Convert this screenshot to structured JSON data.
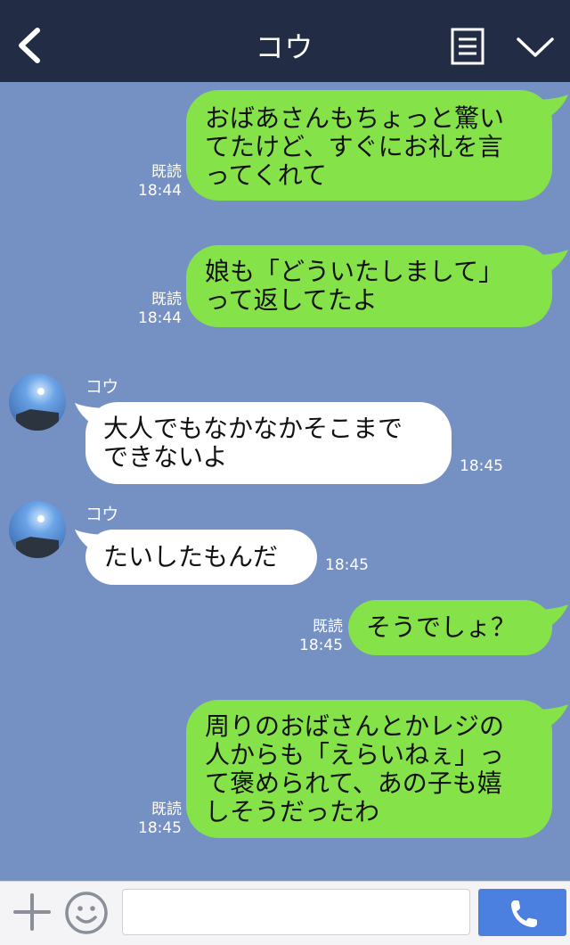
{
  "header": {
    "title": "コウ",
    "back_icon": "chevron-left-icon",
    "menu_icon": "note-list-icon",
    "collapse_icon": "chevron-down-icon"
  },
  "messages": [
    {
      "from": "me",
      "lines": [
        "おばあさんもちょっと驚い",
        "てたけど、すぐにお礼を言",
        "ってくれて"
      ],
      "read": "既読",
      "time": "18:44"
    },
    {
      "from": "me",
      "lines": [
        "娘も「どういたしまして」",
        "って返してたよ"
      ],
      "read": "既読",
      "time": "18:44"
    },
    {
      "from": "them",
      "sender": "コウ",
      "lines": [
        "大人でもなかなかそこまで",
        "できないよ"
      ],
      "time": "18:45"
    },
    {
      "from": "them",
      "sender": "コウ",
      "lines": [
        "たいしたもんだ"
      ],
      "time": "18:45"
    },
    {
      "from": "me",
      "lines": [
        "そうでしょ？"
      ],
      "read": "既読",
      "time": "18:45"
    },
    {
      "from": "me",
      "lines": [
        "周りのおばさんとかレジの",
        "人からも「えらいねぇ」っ",
        "て褒められて、あの子も嬉",
        "しそうだったわ"
      ],
      "read": "既読",
      "time": "18:45"
    }
  ],
  "composer": {
    "plus_icon": "plus-icon",
    "emoji_icon": "smiley-icon",
    "input_placeholder": "",
    "send_icon": "phone-icon"
  },
  "colors": {
    "header_bg": "#232c45",
    "chat_bg": "#7590c2",
    "my_bubble": "#85e249",
    "their_bubble": "#ffffff",
    "send_button": "#4b7fe0"
  }
}
